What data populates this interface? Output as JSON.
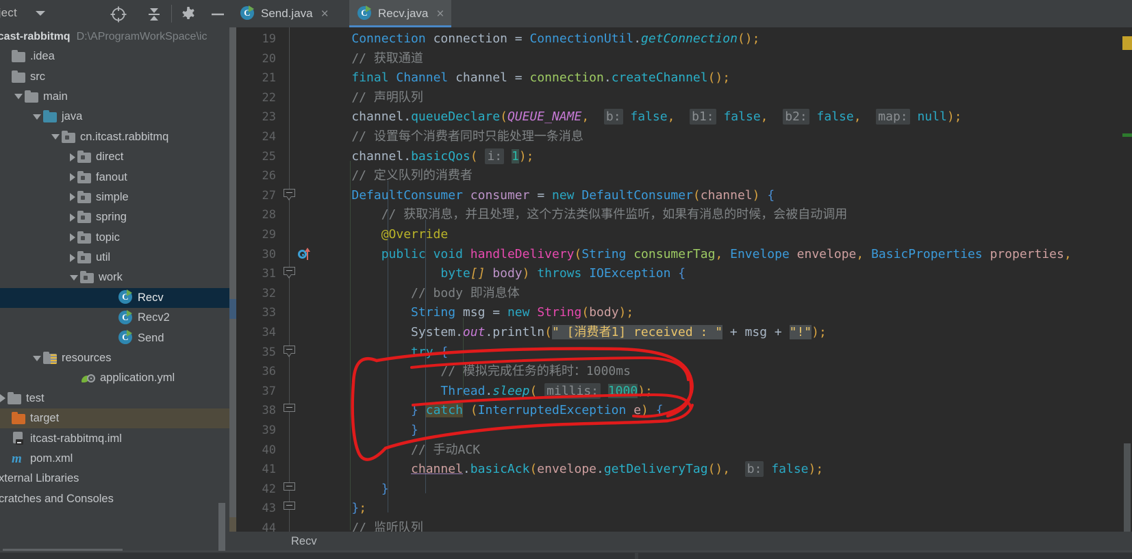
{
  "toolbar": {
    "project_label": "oject",
    "icons": [
      {
        "name": "locate-icon",
        "glyph": "crosshair"
      },
      {
        "name": "collapse-all-icon",
        "glyph": "collapse"
      },
      {
        "name": "settings-gear-icon",
        "glyph": "gear"
      },
      {
        "name": "hide-icon",
        "glyph": "minus"
      }
    ]
  },
  "tabs": [
    {
      "label": "Send.java",
      "active": false,
      "icon": "java-class-runnable-icon",
      "close": "×"
    },
    {
      "label": "Recv.java",
      "active": true,
      "icon": "java-class-runnable-icon",
      "close": "×"
    }
  ],
  "project": {
    "name": "itcast-rabbitmq",
    "path": "D:\\AProgramWorkSpace\\ic",
    "tree": [
      {
        "label": ".idea",
        "indent": 0,
        "arrow": "none",
        "icon": "folder",
        "sel": false
      },
      {
        "label": "src",
        "indent": 0,
        "arrow": "none",
        "icon": "folder",
        "sel": false
      },
      {
        "label": "main",
        "indent": 1,
        "arrow": "down",
        "icon": "folder",
        "sel": false
      },
      {
        "label": "java",
        "indent": 2,
        "arrow": "down",
        "icon": "folder-teal",
        "sel": false
      },
      {
        "label": "cn.itcast.rabbitmq",
        "indent": 3,
        "arrow": "down",
        "icon": "package",
        "sel": false
      },
      {
        "label": "direct",
        "indent": 4,
        "arrow": "right",
        "icon": "package",
        "sel": false
      },
      {
        "label": "fanout",
        "indent": 4,
        "arrow": "right",
        "icon": "package",
        "sel": false
      },
      {
        "label": "simple",
        "indent": 4,
        "arrow": "right",
        "icon": "package",
        "sel": false
      },
      {
        "label": "spring",
        "indent": 4,
        "arrow": "right",
        "icon": "package",
        "sel": false
      },
      {
        "label": "topic",
        "indent": 4,
        "arrow": "right",
        "icon": "package",
        "sel": false
      },
      {
        "label": "util",
        "indent": 4,
        "arrow": "right",
        "icon": "package",
        "sel": false
      },
      {
        "label": "work",
        "indent": 4,
        "arrow": "down",
        "icon": "package",
        "sel": false
      },
      {
        "label": "Recv",
        "indent": 6,
        "arrow": "none",
        "icon": "java-class",
        "sel": true
      },
      {
        "label": "Recv2",
        "indent": 6,
        "arrow": "none",
        "icon": "java-class",
        "sel": false
      },
      {
        "label": "Send",
        "indent": 6,
        "arrow": "none",
        "icon": "java-class",
        "sel": false
      },
      {
        "label": "resources",
        "indent": 2,
        "arrow": "down",
        "icon": "folder-res",
        "sel": false
      },
      {
        "label": "application.yml",
        "indent": 4,
        "arrow": "none",
        "icon": "yml",
        "sel": false
      },
      {
        "label": "test",
        "indent": 0,
        "arrow": "right",
        "icon": "folder",
        "sel": false
      },
      {
        "label": "target",
        "indent": 0,
        "arrow": "none",
        "icon": "folder-orange",
        "sel": false,
        "target": true
      },
      {
        "label": "itcast-rabbitmq.iml",
        "indent": 0,
        "arrow": "none",
        "icon": "iml",
        "sel": false
      },
      {
        "label": "pom.xml",
        "indent": 0,
        "arrow": "none",
        "icon": "maven",
        "sel": false
      }
    ],
    "extra_rows": [
      "External Libraries",
      "Scratches and Consoles"
    ]
  },
  "editor": {
    "first_line": 19,
    "last_line": 44,
    "line_height": 28.6,
    "fold_markers": [
      27,
      31,
      35,
      38,
      42,
      43
    ],
    "override_marker_line": 30,
    "highlighted_line": 33,
    "breadcrumb": "Recv",
    "markers": [
      {
        "name": "warning-marker",
        "color": "#c5a22a"
      },
      {
        "name": "info-marker",
        "color": "#2d7a2d"
      }
    ],
    "lines": [
      {
        "n": 19,
        "segs": [
          {
            "t": "    ",
            "c": ""
          },
          {
            "t": "Connection",
            "c": "cls"
          },
          {
            "t": " connection ",
            "c": ""
          },
          {
            "t": "=",
            "c": ""
          },
          {
            "t": " ",
            "c": ""
          },
          {
            "t": "ConnectionUtil",
            "c": "cls"
          },
          {
            "t": ".",
            "c": ""
          },
          {
            "t": "getConnection",
            "c": "mth italic"
          },
          {
            "t": "()",
            "c": "pn"
          },
          {
            "t": ";",
            "c": "pn"
          }
        ]
      },
      {
        "n": 20,
        "segs": [
          {
            "t": "    // 获取通道",
            "c": "cmt"
          }
        ]
      },
      {
        "n": 21,
        "segs": [
          {
            "t": "    ",
            "c": ""
          },
          {
            "t": "final",
            "c": "kw"
          },
          {
            "t": " ",
            "c": ""
          },
          {
            "t": "Channel",
            "c": "cls"
          },
          {
            "t": " channel ",
            "c": ""
          },
          {
            "t": "=",
            "c": ""
          },
          {
            "t": " connection",
            "c": "var"
          },
          {
            "t": ".",
            "c": ""
          },
          {
            "t": "createChannel",
            "c": "mth"
          },
          {
            "t": "()",
            "c": "pn"
          },
          {
            "t": ";",
            "c": "pn"
          }
        ]
      },
      {
        "n": 22,
        "segs": [
          {
            "t": "    // 声明队列",
            "c": "cmt"
          }
        ]
      },
      {
        "n": 23,
        "segs": [
          {
            "t": "    channel",
            "c": ""
          },
          {
            "t": ".",
            "c": ""
          },
          {
            "t": "queueDeclare",
            "c": "mth"
          },
          {
            "t": "(",
            "c": "pn"
          },
          {
            "t": "QUEUE_NAME",
            "c": "varm italic"
          },
          {
            "t": ",",
            "c": "pn"
          },
          {
            "t": "  ",
            "c": ""
          },
          {
            "t": "b:",
            "c": "hint"
          },
          {
            "t": " ",
            "c": ""
          },
          {
            "t": "false",
            "c": "kw"
          },
          {
            "t": ",",
            "c": "pn"
          },
          {
            "t": "  ",
            "c": ""
          },
          {
            "t": "b1:",
            "c": "hint"
          },
          {
            "t": " ",
            "c": ""
          },
          {
            "t": "false",
            "c": "kw"
          },
          {
            "t": ",",
            "c": "pn"
          },
          {
            "t": "  ",
            "c": ""
          },
          {
            "t": "b2:",
            "c": "hint"
          },
          {
            "t": " ",
            "c": ""
          },
          {
            "t": "false",
            "c": "kw"
          },
          {
            "t": ",",
            "c": "pn"
          },
          {
            "t": "  ",
            "c": ""
          },
          {
            "t": "map:",
            "c": "hint"
          },
          {
            "t": " ",
            "c": ""
          },
          {
            "t": "null",
            "c": "kw"
          },
          {
            "t": ")",
            "c": "pn"
          },
          {
            "t": ";",
            "c": "pn"
          }
        ]
      },
      {
        "n": 24,
        "segs": [
          {
            "t": "    // 设置每个消费者同时只能处理一条消息",
            "c": "cmt"
          }
        ]
      },
      {
        "n": 25,
        "segs": [
          {
            "t": "    channel",
            "c": ""
          },
          {
            "t": ".",
            "c": ""
          },
          {
            "t": "basicQos",
            "c": "mth"
          },
          {
            "t": "(",
            "c": "pn"
          },
          {
            "t": " ",
            "c": ""
          },
          {
            "t": "i:",
            "c": "hint"
          },
          {
            "t": " ",
            "c": ""
          },
          {
            "t": "1",
            "c": "num hlg"
          },
          {
            "t": ")",
            "c": "pn"
          },
          {
            "t": ";",
            "c": "pn"
          }
        ]
      },
      {
        "n": 26,
        "segs": [
          {
            "t": "    // 定义队列的消费者",
            "c": "cmt"
          }
        ]
      },
      {
        "n": 27,
        "segs": [
          {
            "t": "    ",
            "c": ""
          },
          {
            "t": "DefaultConsumer",
            "c": "cls"
          },
          {
            "t": " ",
            "c": ""
          },
          {
            "t": "consumer",
            "c": "varf"
          },
          {
            "t": " ",
            "c": ""
          },
          {
            "t": "=",
            "c": ""
          },
          {
            "t": " ",
            "c": ""
          },
          {
            "t": "new",
            "c": "kw"
          },
          {
            "t": " ",
            "c": ""
          },
          {
            "t": "DefaultConsumer",
            "c": "cls"
          },
          {
            "t": "(",
            "c": "pn"
          },
          {
            "t": "channel",
            "c": "fld"
          },
          {
            "t": ")",
            "c": "pn"
          },
          {
            "t": " ",
            "c": ""
          },
          {
            "t": "{",
            "c": "brc"
          }
        ]
      },
      {
        "n": 28,
        "segs": [
          {
            "t": "        // 获取消息，并且处理，这个方法类似事件监听，如果有消息的时候，会被自动调用",
            "c": "cmt"
          }
        ]
      },
      {
        "n": 29,
        "segs": [
          {
            "t": "        @Override",
            "c": "anno"
          }
        ]
      },
      {
        "n": 30,
        "segs": [
          {
            "t": "        ",
            "c": ""
          },
          {
            "t": "public",
            "c": "kw"
          },
          {
            "t": " ",
            "c": ""
          },
          {
            "t": "void",
            "c": "kw"
          },
          {
            "t": " ",
            "c": ""
          },
          {
            "t": "handleDelivery",
            "c": "mthp"
          },
          {
            "t": "(",
            "c": "pn"
          },
          {
            "t": "String",
            "c": "cls"
          },
          {
            "t": " ",
            "c": ""
          },
          {
            "t": "consumerTag",
            "c": "var"
          },
          {
            "t": ", ",
            "c": "pn"
          },
          {
            "t": "Envelope",
            "c": "cls"
          },
          {
            "t": " ",
            "c": ""
          },
          {
            "t": "envelope",
            "c": "fld"
          },
          {
            "t": ", ",
            "c": "pn"
          },
          {
            "t": "BasicProperties",
            "c": "cls"
          },
          {
            "t": " ",
            "c": ""
          },
          {
            "t": "properties",
            "c": "fld"
          },
          {
            "t": ",",
            "c": "pn"
          }
        ]
      },
      {
        "n": 31,
        "segs": [
          {
            "t": "                ",
            "c": ""
          },
          {
            "t": "byte",
            "c": "kw"
          },
          {
            "t": "[]",
            "c": "brc2 italic"
          },
          {
            "t": " ",
            "c": ""
          },
          {
            "t": "body",
            "c": "varf"
          },
          {
            "t": ")",
            "c": "pn"
          },
          {
            "t": " ",
            "c": ""
          },
          {
            "t": "throws",
            "c": "kw"
          },
          {
            "t": " ",
            "c": ""
          },
          {
            "t": "IOException",
            "c": "cls"
          },
          {
            "t": " ",
            "c": ""
          },
          {
            "t": "{",
            "c": "brc"
          }
        ]
      },
      {
        "n": 32,
        "segs": [
          {
            "t": "            // body 即消息体",
            "c": "cmt"
          }
        ]
      },
      {
        "n": 33,
        "segs": [
          {
            "t": "            ",
            "c": ""
          },
          {
            "t": "String",
            "c": "cls"
          },
          {
            "t": " msg ",
            "c": ""
          },
          {
            "t": "=",
            "c": ""
          },
          {
            "t": " ",
            "c": ""
          },
          {
            "t": "new",
            "c": "kw"
          },
          {
            "t": " ",
            "c": ""
          },
          {
            "t": "String",
            "c": "mthp"
          },
          {
            "t": "(",
            "c": "pn"
          },
          {
            "t": "body",
            "c": "fld"
          },
          {
            "t": ")",
            "c": "pn"
          },
          {
            "t": ";",
            "c": "pn"
          }
        ]
      },
      {
        "n": 34,
        "segs": [
          {
            "t": "            ",
            "c": ""
          },
          {
            "t": "System",
            "c": ""
          },
          {
            "t": ".",
            "c": ""
          },
          {
            "t": "out",
            "c": "varm italic"
          },
          {
            "t": ".",
            "c": ""
          },
          {
            "t": "println",
            "c": ""
          },
          {
            "t": "(",
            "c": "pn"
          },
          {
            "t": "\" [消费者1] received : \"",
            "c": "str hl"
          },
          {
            "t": " + msg + ",
            "c": ""
          },
          {
            "t": "\"!\"",
            "c": "str hl"
          },
          {
            "t": ")",
            "c": "pn"
          },
          {
            "t": ";",
            "c": "pn"
          }
        ]
      },
      {
        "n": 35,
        "segs": [
          {
            "t": "            ",
            "c": ""
          },
          {
            "t": "try",
            "c": "kw"
          },
          {
            "t": " ",
            "c": ""
          },
          {
            "t": "{",
            "c": "brc"
          }
        ]
      },
      {
        "n": 36,
        "segs": [
          {
            "t": "                // 模拟完成任务的耗时：1000ms",
            "c": "cmt"
          }
        ]
      },
      {
        "n": 37,
        "segs": [
          {
            "t": "                ",
            "c": ""
          },
          {
            "t": "Thread",
            "c": "cls"
          },
          {
            "t": ".",
            "c": ""
          },
          {
            "t": "sleep",
            "c": "mth italic"
          },
          {
            "t": "(",
            "c": "pn"
          },
          {
            "t": " ",
            "c": ""
          },
          {
            "t": "millis:",
            "c": "hint"
          },
          {
            "t": " ",
            "c": ""
          },
          {
            "t": "1000",
            "c": "num hlg"
          },
          {
            "t": ")",
            "c": "pn"
          },
          {
            "t": ";",
            "c": "pn"
          }
        ]
      },
      {
        "n": 38,
        "segs": [
          {
            "t": "            ",
            "c": ""
          },
          {
            "t": "}",
            "c": "brc"
          },
          {
            "t": " ",
            "c": ""
          },
          {
            "t": "catch",
            "c": "kw hly"
          },
          {
            "t": " ",
            "c": ""
          },
          {
            "t": "(",
            "c": "pn"
          },
          {
            "t": "InterruptedException",
            "c": "cls"
          },
          {
            "t": " ",
            "c": ""
          },
          {
            "t": "e",
            "c": "fld"
          },
          {
            "t": ")",
            "c": "pn"
          },
          {
            "t": " ",
            "c": ""
          },
          {
            "t": "{",
            "c": "brc"
          }
        ]
      },
      {
        "n": 39,
        "segs": [
          {
            "t": "            ",
            "c": ""
          },
          {
            "t": "}",
            "c": "brc"
          }
        ]
      },
      {
        "n": 40,
        "segs": [
          {
            "t": "            // 手动ACK",
            "c": "cmt"
          }
        ]
      },
      {
        "n": 41,
        "segs": [
          {
            "t": "            ",
            "c": ""
          },
          {
            "t": "channel",
            "c": "fld uline"
          },
          {
            "t": ".",
            "c": ""
          },
          {
            "t": "basicAck",
            "c": "mth"
          },
          {
            "t": "(",
            "c": "pn"
          },
          {
            "t": "envelope",
            "c": "fld"
          },
          {
            "t": ".",
            "c": ""
          },
          {
            "t": "getDeliveryTag",
            "c": "mth"
          },
          {
            "t": "()",
            "c": "pn"
          },
          {
            "t": ",",
            "c": "pn"
          },
          {
            "t": "  ",
            "c": ""
          },
          {
            "t": "b:",
            "c": "hint"
          },
          {
            "t": " ",
            "c": ""
          },
          {
            "t": "false",
            "c": "kw"
          },
          {
            "t": ")",
            "c": "pn"
          },
          {
            "t": ";",
            "c": "pn"
          }
        ]
      },
      {
        "n": 42,
        "segs": [
          {
            "t": "        ",
            "c": ""
          },
          {
            "t": "}",
            "c": "brc"
          }
        ]
      },
      {
        "n": 43,
        "segs": [
          {
            "t": "    ",
            "c": ""
          },
          {
            "t": "}",
            "c": "brc"
          },
          {
            "t": ";",
            "c": "pn"
          }
        ]
      },
      {
        "n": 44,
        "segs": [
          {
            "t": "    // 监听队列",
            "c": "cmt"
          }
        ]
      }
    ]
  },
  "annotation": {
    "name": "red-hand-drawn-circle",
    "color": "#e01b1b",
    "stroke": 4
  }
}
